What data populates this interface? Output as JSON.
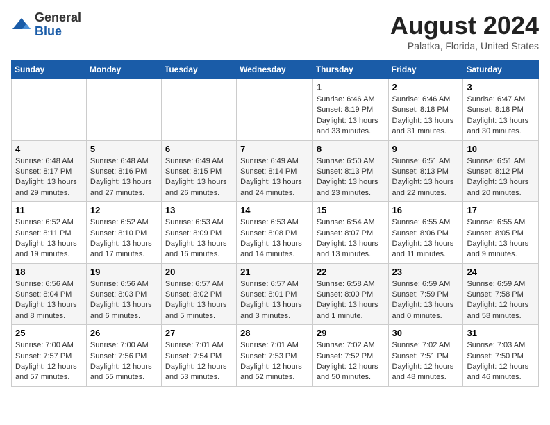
{
  "logo": {
    "general": "General",
    "blue": "Blue"
  },
  "title": "August 2024",
  "location": "Palatka, Florida, United States",
  "days_of_week": [
    "Sunday",
    "Monday",
    "Tuesday",
    "Wednesday",
    "Thursday",
    "Friday",
    "Saturday"
  ],
  "weeks": [
    [
      {
        "day": "",
        "content": ""
      },
      {
        "day": "",
        "content": ""
      },
      {
        "day": "",
        "content": ""
      },
      {
        "day": "",
        "content": ""
      },
      {
        "day": "1",
        "content": "Sunrise: 6:46 AM\nSunset: 8:19 PM\nDaylight: 13 hours\nand 33 minutes."
      },
      {
        "day": "2",
        "content": "Sunrise: 6:46 AM\nSunset: 8:18 PM\nDaylight: 13 hours\nand 31 minutes."
      },
      {
        "day": "3",
        "content": "Sunrise: 6:47 AM\nSunset: 8:18 PM\nDaylight: 13 hours\nand 30 minutes."
      }
    ],
    [
      {
        "day": "4",
        "content": "Sunrise: 6:48 AM\nSunset: 8:17 PM\nDaylight: 13 hours\nand 29 minutes."
      },
      {
        "day": "5",
        "content": "Sunrise: 6:48 AM\nSunset: 8:16 PM\nDaylight: 13 hours\nand 27 minutes."
      },
      {
        "day": "6",
        "content": "Sunrise: 6:49 AM\nSunset: 8:15 PM\nDaylight: 13 hours\nand 26 minutes."
      },
      {
        "day": "7",
        "content": "Sunrise: 6:49 AM\nSunset: 8:14 PM\nDaylight: 13 hours\nand 24 minutes."
      },
      {
        "day": "8",
        "content": "Sunrise: 6:50 AM\nSunset: 8:13 PM\nDaylight: 13 hours\nand 23 minutes."
      },
      {
        "day": "9",
        "content": "Sunrise: 6:51 AM\nSunset: 8:13 PM\nDaylight: 13 hours\nand 22 minutes."
      },
      {
        "day": "10",
        "content": "Sunrise: 6:51 AM\nSunset: 8:12 PM\nDaylight: 13 hours\nand 20 minutes."
      }
    ],
    [
      {
        "day": "11",
        "content": "Sunrise: 6:52 AM\nSunset: 8:11 PM\nDaylight: 13 hours\nand 19 minutes."
      },
      {
        "day": "12",
        "content": "Sunrise: 6:52 AM\nSunset: 8:10 PM\nDaylight: 13 hours\nand 17 minutes."
      },
      {
        "day": "13",
        "content": "Sunrise: 6:53 AM\nSunset: 8:09 PM\nDaylight: 13 hours\nand 16 minutes."
      },
      {
        "day": "14",
        "content": "Sunrise: 6:53 AM\nSunset: 8:08 PM\nDaylight: 13 hours\nand 14 minutes."
      },
      {
        "day": "15",
        "content": "Sunrise: 6:54 AM\nSunset: 8:07 PM\nDaylight: 13 hours\nand 13 minutes."
      },
      {
        "day": "16",
        "content": "Sunrise: 6:55 AM\nSunset: 8:06 PM\nDaylight: 13 hours\nand 11 minutes."
      },
      {
        "day": "17",
        "content": "Sunrise: 6:55 AM\nSunset: 8:05 PM\nDaylight: 13 hours\nand 9 minutes."
      }
    ],
    [
      {
        "day": "18",
        "content": "Sunrise: 6:56 AM\nSunset: 8:04 PM\nDaylight: 13 hours\nand 8 minutes."
      },
      {
        "day": "19",
        "content": "Sunrise: 6:56 AM\nSunset: 8:03 PM\nDaylight: 13 hours\nand 6 minutes."
      },
      {
        "day": "20",
        "content": "Sunrise: 6:57 AM\nSunset: 8:02 PM\nDaylight: 13 hours\nand 5 minutes."
      },
      {
        "day": "21",
        "content": "Sunrise: 6:57 AM\nSunset: 8:01 PM\nDaylight: 13 hours\nand 3 minutes."
      },
      {
        "day": "22",
        "content": "Sunrise: 6:58 AM\nSunset: 8:00 PM\nDaylight: 13 hours\nand 1 minute."
      },
      {
        "day": "23",
        "content": "Sunrise: 6:59 AM\nSunset: 7:59 PM\nDaylight: 13 hours\nand 0 minutes."
      },
      {
        "day": "24",
        "content": "Sunrise: 6:59 AM\nSunset: 7:58 PM\nDaylight: 12 hours\nand 58 minutes."
      }
    ],
    [
      {
        "day": "25",
        "content": "Sunrise: 7:00 AM\nSunset: 7:57 PM\nDaylight: 12 hours\nand 57 minutes."
      },
      {
        "day": "26",
        "content": "Sunrise: 7:00 AM\nSunset: 7:56 PM\nDaylight: 12 hours\nand 55 minutes."
      },
      {
        "day": "27",
        "content": "Sunrise: 7:01 AM\nSunset: 7:54 PM\nDaylight: 12 hours\nand 53 minutes."
      },
      {
        "day": "28",
        "content": "Sunrise: 7:01 AM\nSunset: 7:53 PM\nDaylight: 12 hours\nand 52 minutes."
      },
      {
        "day": "29",
        "content": "Sunrise: 7:02 AM\nSunset: 7:52 PM\nDaylight: 12 hours\nand 50 minutes."
      },
      {
        "day": "30",
        "content": "Sunrise: 7:02 AM\nSunset: 7:51 PM\nDaylight: 12 hours\nand 48 minutes."
      },
      {
        "day": "31",
        "content": "Sunrise: 7:03 AM\nSunset: 7:50 PM\nDaylight: 12 hours\nand 46 minutes."
      }
    ]
  ]
}
